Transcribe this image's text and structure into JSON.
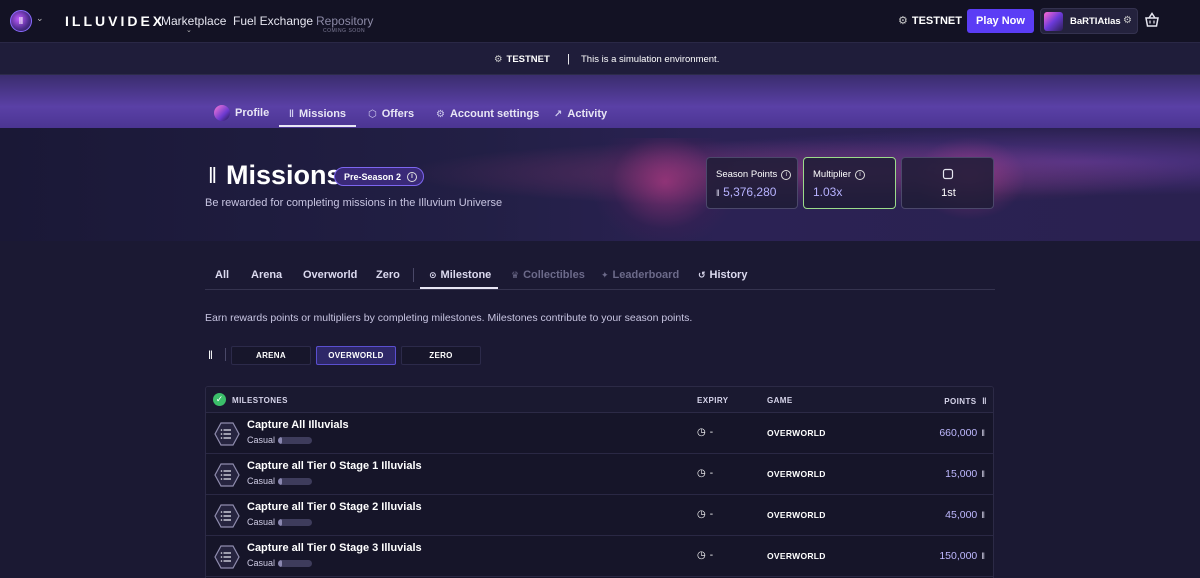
{
  "nav": {
    "brand": "ILLUVIDEX",
    "links": [
      "Marketplace",
      "Fuel Exchange",
      "Repository"
    ],
    "repository_sub": "COMING SOON",
    "testnet": "TESTNET",
    "play_now": "Play Now",
    "username": "BaRTIAtlas"
  },
  "banner": {
    "tag": "TESTNET",
    "separator": "|",
    "message": "This is a simulation environment."
  },
  "profile_tabs": [
    "Profile",
    "Missions",
    "Offers",
    "Account settings",
    "Activity"
  ],
  "hero": {
    "title": "Missions",
    "season": "Pre-Season 2",
    "subtitle": "Be rewarded for completing missions in the Illuvium Universe",
    "season_points_label": "Season Points",
    "season_points_value": "5,376,280",
    "multiplier_label": "Multiplier",
    "multiplier_value": "1.03x",
    "rank_value": "1st"
  },
  "filter_tabs": [
    "All",
    "Arena",
    "Overworld",
    "Zero",
    "Milestone",
    "Collectibles",
    "Leaderboard",
    "History"
  ],
  "intro": "Earn rewards points or multipliers by completing milestones. Milestones contribute to your season points.",
  "game_filters": [
    "ARENA",
    "OVERWORLD",
    "ZERO"
  ],
  "table": {
    "headers": [
      "MILESTONES",
      "EXPIRY",
      "GAME",
      "POINTS"
    ],
    "rows": [
      {
        "title": "Capture All Illuvials",
        "difficulty": "Casual",
        "progress": 0.12,
        "expiry": "-",
        "game": "OVERWORLD",
        "points": "660,000"
      },
      {
        "title": "Capture all Tier 0 Stage 1 Illuvials",
        "difficulty": "Casual",
        "progress": 0.12,
        "expiry": "-",
        "game": "OVERWORLD",
        "points": "15,000"
      },
      {
        "title": "Capture all Tier 0 Stage 2 Illuvials",
        "difficulty": "Casual",
        "progress": 0.12,
        "expiry": "-",
        "game": "OVERWORLD",
        "points": "45,000"
      },
      {
        "title": "Capture all Tier 0 Stage 3 Illuvials",
        "difficulty": "Casual",
        "progress": 0.12,
        "expiry": "-",
        "game": "OVERWORLD",
        "points": "150,000"
      }
    ]
  },
  "colors": {
    "accent": "#5b3df5",
    "points": "#bfb9ff",
    "milestone_check": "#3bbf6a",
    "multiplier_border": "#9bdc8a"
  }
}
